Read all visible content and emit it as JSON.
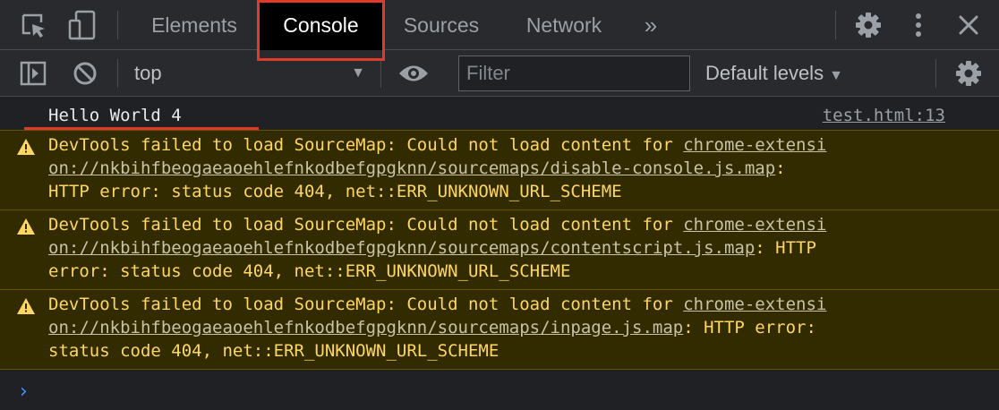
{
  "tabs": [
    {
      "label": "Elements"
    },
    {
      "label": "Console",
      "active": true
    },
    {
      "label": "Sources"
    },
    {
      "label": "Network"
    }
  ],
  "more_tabs_label": "»",
  "toolbar": {
    "context": "top",
    "filter_placeholder": "Filter",
    "levels_label": "Default levels"
  },
  "log": {
    "text": "Hello World 4",
    "source": "test.html:13"
  },
  "warnings": [
    {
      "line1_pre": "DevTools failed to load SourceMap: Could not load content for ",
      "line1_link": "chrome-extensi",
      "line2_link": "on://nkbihfbeogaeaoehlefnkodbefgpgknn/sourcemaps/disable-console.js.map",
      "line2_post": ":",
      "line3": "HTTP error: status code 404, net::ERR_UNKNOWN_URL_SCHEME"
    },
    {
      "line1_pre": "DevTools failed to load SourceMap: Could not load content for ",
      "line1_link": "chrome-extensi",
      "line2_link": "on://nkbihfbeogaeaoehlefnkodbefgpgknn/sourcemaps/contentscript.js.map",
      "line2_post": ": HTTP",
      "line3": "error: status code 404, net::ERR_UNKNOWN_URL_SCHEME"
    },
    {
      "line1_pre": "DevTools failed to load SourceMap: Could not load content for ",
      "line1_link": "chrome-extensi",
      "line2_link": "on://nkbihfbeogaeaoehlefnkodbefgpgknn/sourcemaps/inpage.js.map",
      "line2_post": ": HTTP error:",
      "line3": "status code 404, net::ERR_UNKNOWN_URL_SCHEME"
    }
  ],
  "prompt_symbol": "›",
  "colors": {
    "warning_text": "#fdd663",
    "warning_bg": "#332b00",
    "highlight": "#e03a2b",
    "prompt": "#4c8bf5"
  }
}
